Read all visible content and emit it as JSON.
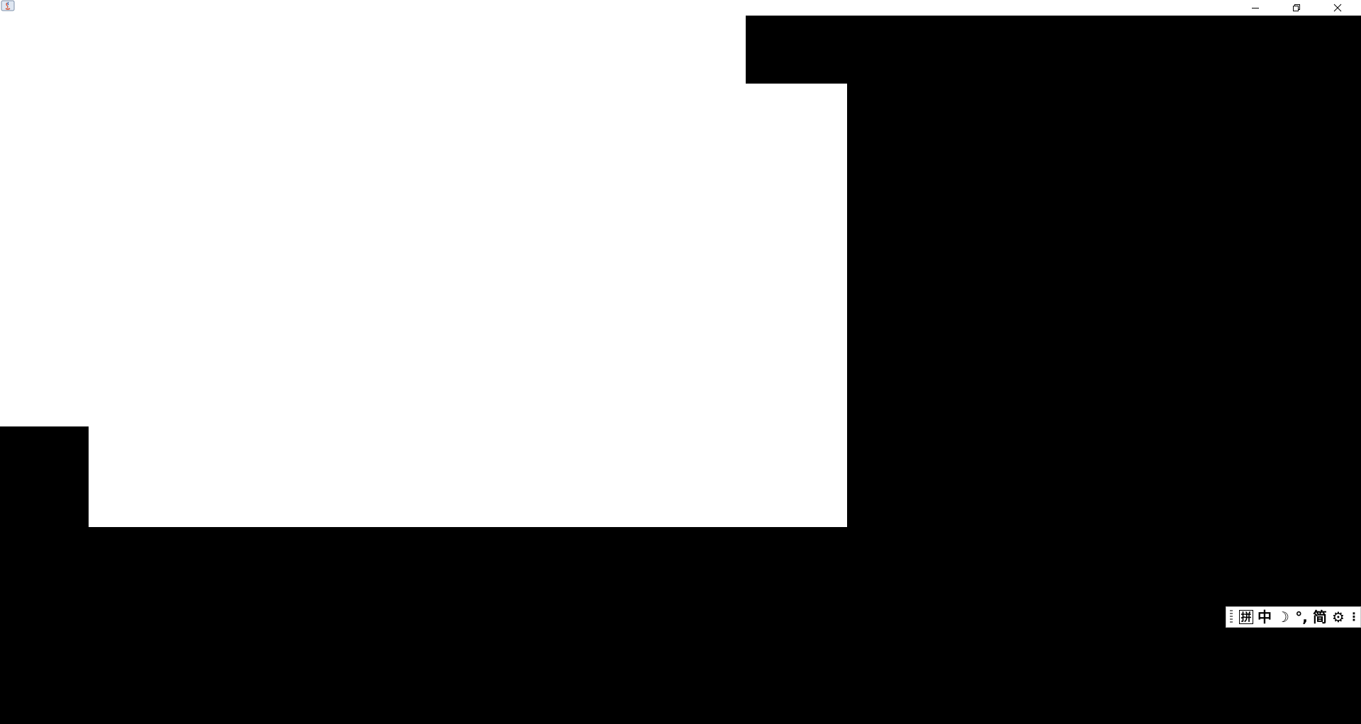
{
  "window": {
    "title": "",
    "controls": {
      "minimize": "minimize",
      "restore": "restore",
      "close": "close"
    }
  },
  "ime_toolbar": {
    "mode": "拼",
    "language": "中",
    "half_full": "☽",
    "punctuation": "°,",
    "script": "简",
    "settings": "⚙",
    "more": "⋮"
  },
  "colors": {
    "background": "#000000",
    "canvas": "#ffffff"
  }
}
